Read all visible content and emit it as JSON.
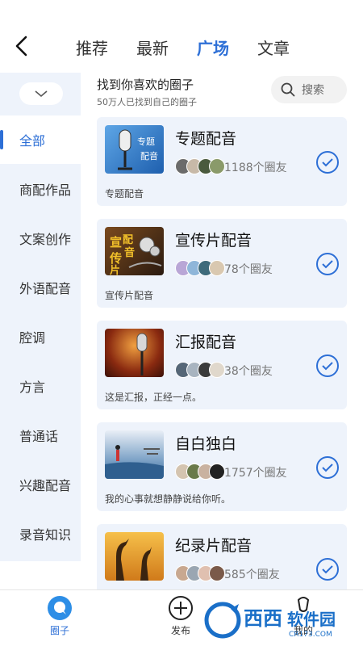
{
  "nav": {
    "tabs": [
      "推荐",
      "最新",
      "广场",
      "文章"
    ],
    "active_tab": "广场"
  },
  "header": {
    "title": "找到你喜欢的圈子",
    "subtitle": "50万人已找到自己的圈子",
    "search_label": "搜索"
  },
  "sidebar": {
    "items": [
      "全部",
      "商配作品",
      "文案创作",
      "外语配音",
      "腔调",
      "方言",
      "普通话",
      "兴趣配音",
      "录音知识"
    ],
    "active": "全部"
  },
  "circles": [
    {
      "title": "专题配音",
      "members": "1188个圈友",
      "desc": "专题配音"
    },
    {
      "title": "宣传片配音",
      "members": "78个圈友",
      "desc": "宣传片配音"
    },
    {
      "title": "汇报配音",
      "members": "38个圈友",
      "desc": "这是汇报，正经一点。"
    },
    {
      "title": "自白独白",
      "members": "1757个圈友",
      "desc": "我的心事就想静静说给你听。"
    },
    {
      "title": "纪录片配音",
      "members": "585个圈友",
      "desc": ""
    }
  ],
  "bottom_nav": {
    "circle": "圈子",
    "publish": "发布",
    "mine": "我的"
  },
  "watermark": {
    "brand": "西西软件园",
    "domain": "CR173.COM"
  },
  "colors": {
    "accent": "#2d6fd6",
    "sidebar_bg": "#eef3fb",
    "card_bg": "#eef3fb"
  }
}
